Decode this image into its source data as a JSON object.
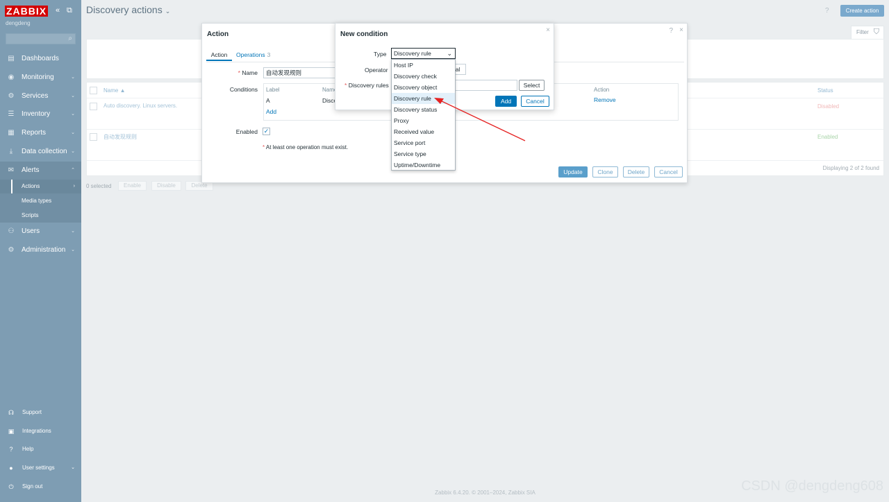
{
  "app": {
    "logo": "ZABBIX",
    "username": "dengdeng"
  },
  "sidebar": {
    "menu": [
      {
        "label": "Dashboards",
        "icon": "dashboard-icon"
      },
      {
        "label": "Monitoring",
        "icon": "eye-icon"
      },
      {
        "label": "Services",
        "icon": "services-icon"
      },
      {
        "label": "Inventory",
        "icon": "list-icon"
      },
      {
        "label": "Reports",
        "icon": "report-icon"
      },
      {
        "label": "Data collection",
        "icon": "download-icon"
      },
      {
        "label": "Alerts",
        "icon": "envelope-icon"
      },
      {
        "label": "Users",
        "icon": "users-icon"
      },
      {
        "label": "Administration",
        "icon": "gear-icon"
      }
    ],
    "alerts_sub": [
      "Actions",
      "Media types",
      "Scripts"
    ],
    "bottom": [
      "Support",
      "Integrations",
      "Help",
      "User settings",
      "Sign out"
    ]
  },
  "header": {
    "title": "Discovery actions",
    "help": "?",
    "create_button": "Create action",
    "filter_tab": "Filter"
  },
  "table": {
    "columns": {
      "name": "Name ▲",
      "status": "Status"
    },
    "rows": [
      {
        "name": "Auto discovery. Linux servers.",
        "status": "Disabled"
      },
      {
        "name": "自动发现规则",
        "status": "Enabled"
      }
    ],
    "displaying": "Displaying 2 of 2 found",
    "selected": "0 selected",
    "mass_buttons": [
      "Enable",
      "Disable",
      "Delete"
    ]
  },
  "footer": "Zabbix 6.4.20. © 2001–2024, Zabbix SIA",
  "watermark": "CSDN @dengdeng608",
  "action_dialog": {
    "title": "Action",
    "help": "?",
    "close": "×",
    "tabs": {
      "action": "Action",
      "operations": "Operations",
      "operations_count": "3"
    },
    "name_label": "Name",
    "name_value": "自动发现规则",
    "conditions_label": "Conditions",
    "cond_columns": {
      "label": "Label",
      "name": "Name",
      "action": "Action"
    },
    "cond_row": {
      "label": "A",
      "name": "Disco",
      "action": "Remove"
    },
    "add_link": "Add",
    "enabled_label": "Enabled",
    "enabled_check": "✓",
    "note": "At least one operation must exist.",
    "buttons": {
      "update": "Update",
      "clone": "Clone",
      "delete": "Delete",
      "cancel": "Cancel"
    }
  },
  "condition_dialog": {
    "title": "New condition",
    "close": "×",
    "type_label": "Type",
    "type_value": "Discovery rule",
    "operator_label": "Operator",
    "operator_value_partial": "al",
    "rules_label": "Discovery rules",
    "select_button": "Select",
    "add_button": "Add",
    "cancel_button": "Cancel",
    "options": [
      "Host IP",
      "Discovery check",
      "Discovery object",
      "Discovery rule",
      "Discovery status",
      "Proxy",
      "Received value",
      "Service port",
      "Service type",
      "Uptime/Downtime"
    ],
    "highlighted": "Discovery rule"
  },
  "colors": {
    "sidebar": "#7e9db3",
    "accent": "#0275b8",
    "logo": "#d40000",
    "annotation_arrow": "#e52222"
  }
}
